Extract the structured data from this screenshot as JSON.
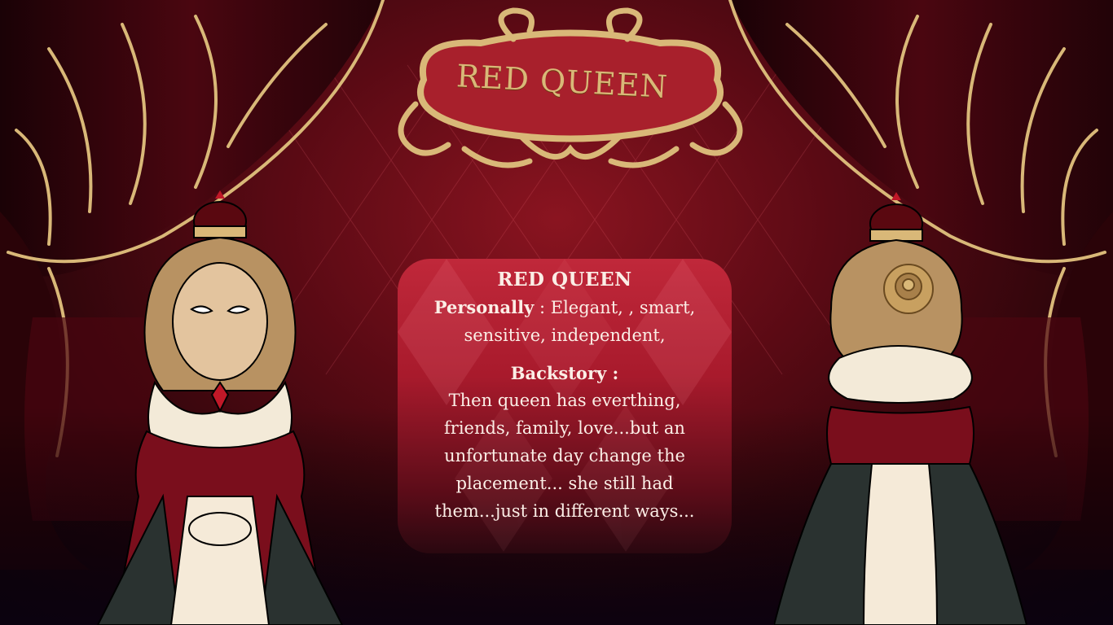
{
  "plaque": {
    "title": "RED QUEEN"
  },
  "card": {
    "title": "RED QUEEN",
    "personality_label": "Personally",
    "personality_sep": " : ",
    "personality_line1": "Elegant, , smart,",
    "personality_line2": "sensitive, independent,",
    "backstory_label": "Backstory :",
    "backstory_lines": [
      "Then queen has everthing,",
      "friends, family, love...but an",
      "unfortunate day change the",
      "placement... she still had",
      "them...just in different ways..."
    ]
  },
  "colors": {
    "curtain": "#3a050c",
    "gold": "#d9b878",
    "card_top": "#c0283a",
    "dress_red": "#7a0e1c",
    "hair": "#b89262"
  }
}
